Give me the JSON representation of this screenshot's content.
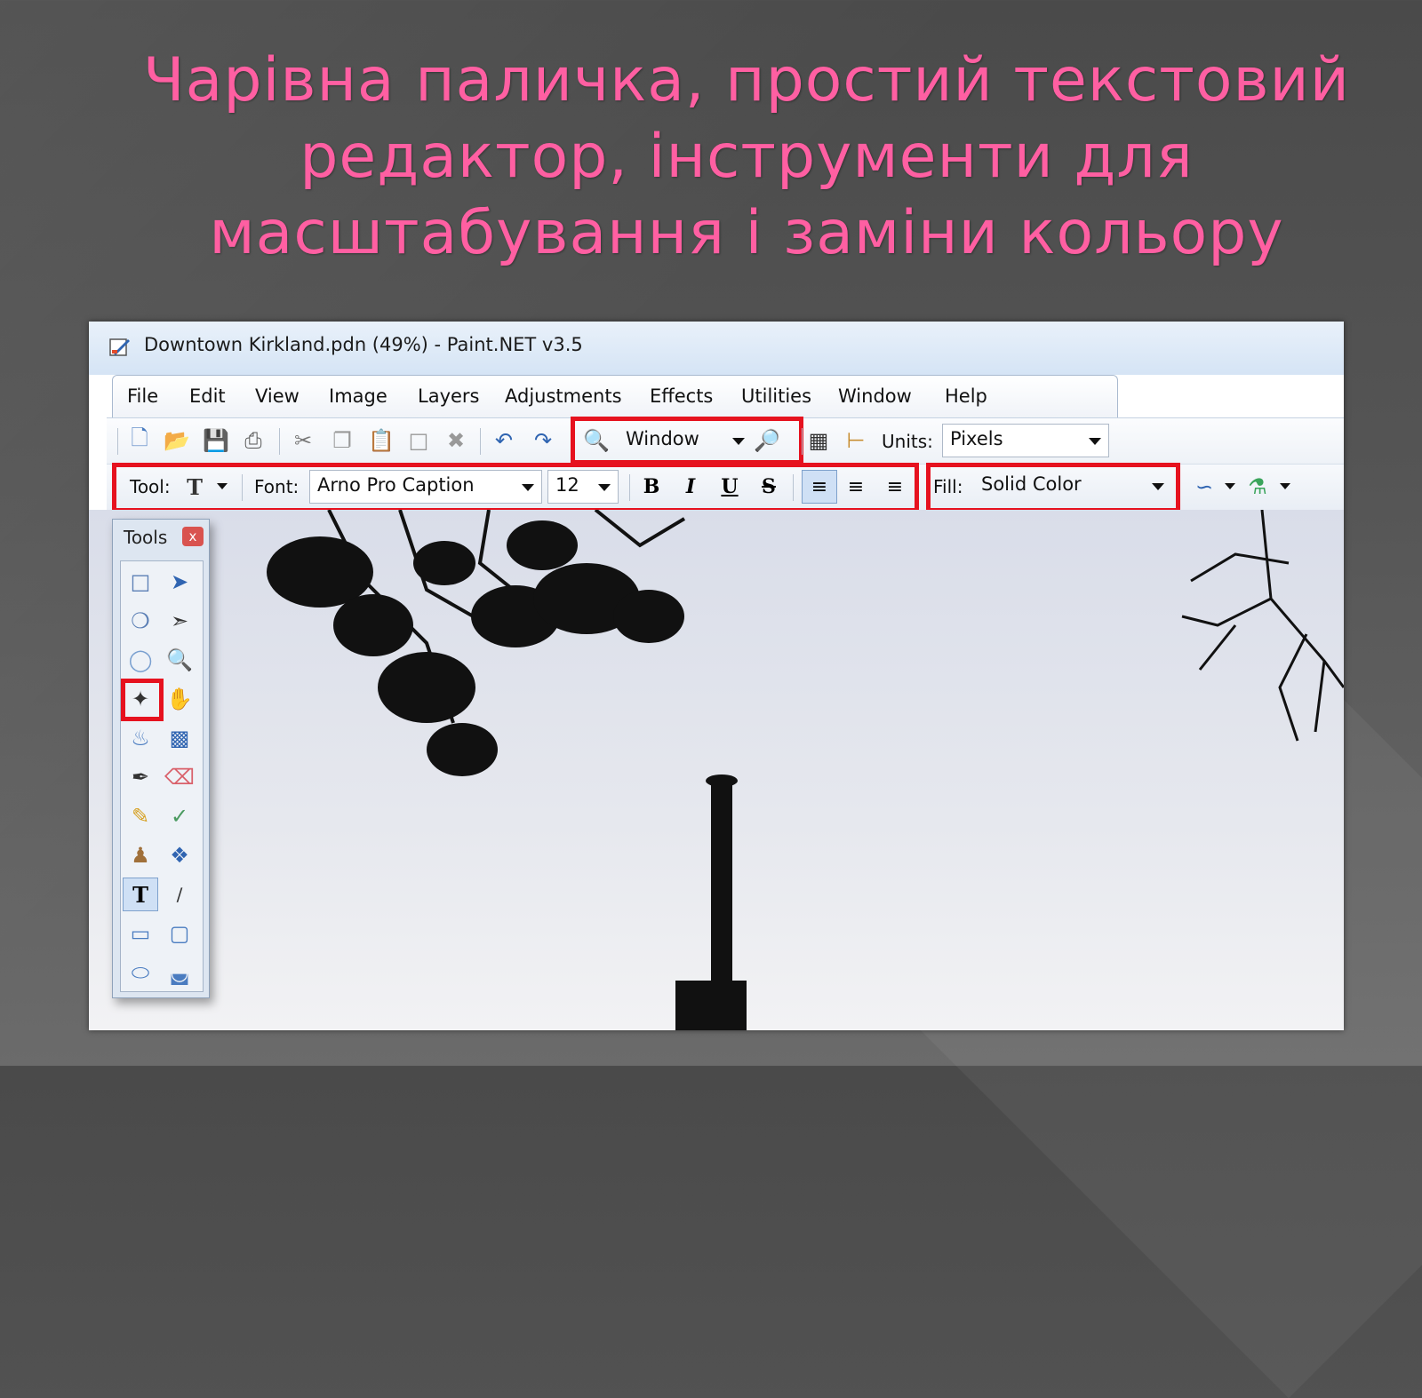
{
  "slide": {
    "title_lines": [
      "Чарівна паличка, простий текстовий",
      "редактор, інструменти для",
      "масштабування і заміни кольору"
    ]
  },
  "window": {
    "title": "Downtown Kirkland.pdn (49%) - Paint.NET v3.5",
    "menu": [
      "File",
      "Edit",
      "View",
      "Image",
      "Layers",
      "Adjustments",
      "Effects",
      "Utilities",
      "Window",
      "Help"
    ]
  },
  "toolbar1": {
    "zoom_value": "Window",
    "units_label": "Units:",
    "units_value": "Pixels"
  },
  "toolbar2": {
    "tool_label": "Tool:",
    "font_label": "Font:",
    "font_value": "Arno Pro Caption",
    "size_value": "12",
    "bold": "B",
    "italic": "I",
    "underline": "U",
    "strike": "S",
    "fill_label": "Fill:",
    "fill_value": "Solid Color"
  },
  "tools_panel": {
    "title": "Tools",
    "close": "x",
    "text_tool": "T"
  },
  "colors": {
    "title": "#ff5fa2",
    "highlight": "#e6121f"
  }
}
